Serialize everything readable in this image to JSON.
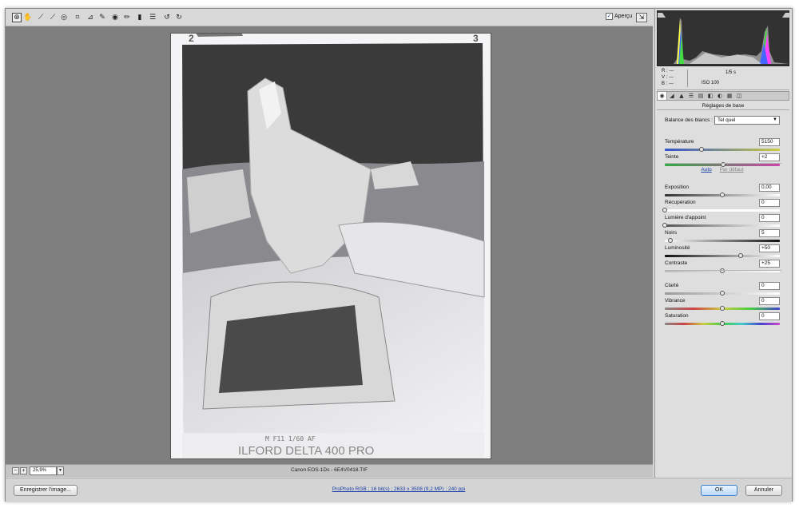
{
  "toolbar": {
    "tools": [
      {
        "name": "zoom-tool",
        "icon": "⊕"
      },
      {
        "name": "hand-tool",
        "icon": "✋"
      },
      {
        "name": "white-balance-tool",
        "icon": "⟋"
      },
      {
        "name": "color-sampler-tool",
        "icon": "⟋"
      },
      {
        "name": "target-adjustment-tool",
        "icon": "◎"
      },
      {
        "name": "crop-tool",
        "icon": "⌗"
      },
      {
        "name": "straighten-tool",
        "icon": "⊿"
      },
      {
        "name": "spot-removal-tool",
        "icon": "✎"
      },
      {
        "name": "red-eye-tool",
        "icon": "◉"
      },
      {
        "name": "adjustment-brush-tool",
        "icon": "✏"
      },
      {
        "name": "graduated-filter-tool",
        "icon": "▮"
      },
      {
        "name": "preferences-tool",
        "icon": "☰"
      },
      {
        "name": "rotate-left-tool",
        "icon": "↺"
      },
      {
        "name": "rotate-right-tool",
        "icon": "↻"
      }
    ],
    "preview_label": "Aperçu",
    "preview_checked": "✓",
    "fullscreen_icon": "⇲"
  },
  "image": {
    "frame_left": "2",
    "frame_right": "3",
    "film_text": "ILFORD DELTA 400 PRO",
    "exposure_text": "M F11  1/60  AF"
  },
  "status": {
    "zoom_minus": "−",
    "zoom_plus": "+",
    "zoom_value": "25,9%",
    "zoom_drop": "▼",
    "filename": "Canon EOS-1Ds  -  6E4V0418.TIF"
  },
  "footer": {
    "save_label": "Enregistrer l'image...",
    "workflow_link": "ProPhoto RGB ; 16 bit(s) ; 2633 x 3508 (9,2 MP) ; 240 ppi",
    "ok_label": "OK",
    "cancel_label": "Annuler"
  },
  "info": {
    "r_label": "R :",
    "r_value": "---",
    "v_label": "V :",
    "v_value": "---",
    "b_label": "B :",
    "b_value": "---",
    "shutter": "1/5 s",
    "iso": "ISO 100"
  },
  "panel": {
    "tabs": [
      "◉",
      "◢",
      "▲",
      "☰",
      "▤",
      "◧",
      "◐",
      "▦",
      "◫"
    ],
    "section_title": "Réglages de base",
    "wb_label": "Balance des blancs :",
    "wb_value": "Tel quel",
    "auto_label": "Auto",
    "default_label": "Par défaut",
    "sliders": [
      {
        "key": "temperature",
        "label": "Température",
        "value": "5150",
        "pos": 0.32,
        "track": "linear-gradient(90deg,#3355cc,#cccc44)"
      },
      {
        "key": "teinte",
        "label": "Teinte",
        "value": "+2",
        "pos": 0.51,
        "track": "linear-gradient(90deg,#33aa44,#cc44aa)"
      },
      {
        "key": "exposition",
        "label": "Exposition",
        "value": "0,00",
        "pos": 0.5,
        "track": "linear-gradient(90deg,#333,#fff)"
      },
      {
        "key": "recuperation",
        "label": "Récupération",
        "value": "0",
        "pos": 0.0,
        "track": "linear-gradient(90deg,#fff,#fff)"
      },
      {
        "key": "lumiere",
        "label": "Lumière d'appoint",
        "value": "0",
        "pos": 0.0,
        "track": "linear-gradient(90deg,#555,#fff)"
      },
      {
        "key": "noirs",
        "label": "Noirs",
        "value": "5",
        "pos": 0.05,
        "track": "linear-gradient(90deg,#fff,#111)"
      },
      {
        "key": "luminosite",
        "label": "Luminosité",
        "value": "+50",
        "pos": 0.66,
        "track": "linear-gradient(90deg,#111,#fff)"
      },
      {
        "key": "contraste",
        "label": "Contraste",
        "value": "+25",
        "pos": 0.5,
        "track": "linear-gradient(90deg,#bbb,#fff)"
      },
      {
        "key": "clarte",
        "label": "Clarté",
        "value": "0",
        "pos": 0.5,
        "track": "linear-gradient(90deg,#999,#fff)"
      },
      {
        "key": "vibrance",
        "label": "Vibrance",
        "value": "0",
        "pos": 0.5,
        "track": "linear-gradient(90deg,#888,#c44,#cc4,#4c4,#44c)"
      },
      {
        "key": "saturation",
        "label": "Saturation",
        "value": "0",
        "pos": 0.5,
        "track": "linear-gradient(90deg,#888,#c44,#cc4,#4c4,#4cc,#44c,#c4c)"
      }
    ]
  }
}
